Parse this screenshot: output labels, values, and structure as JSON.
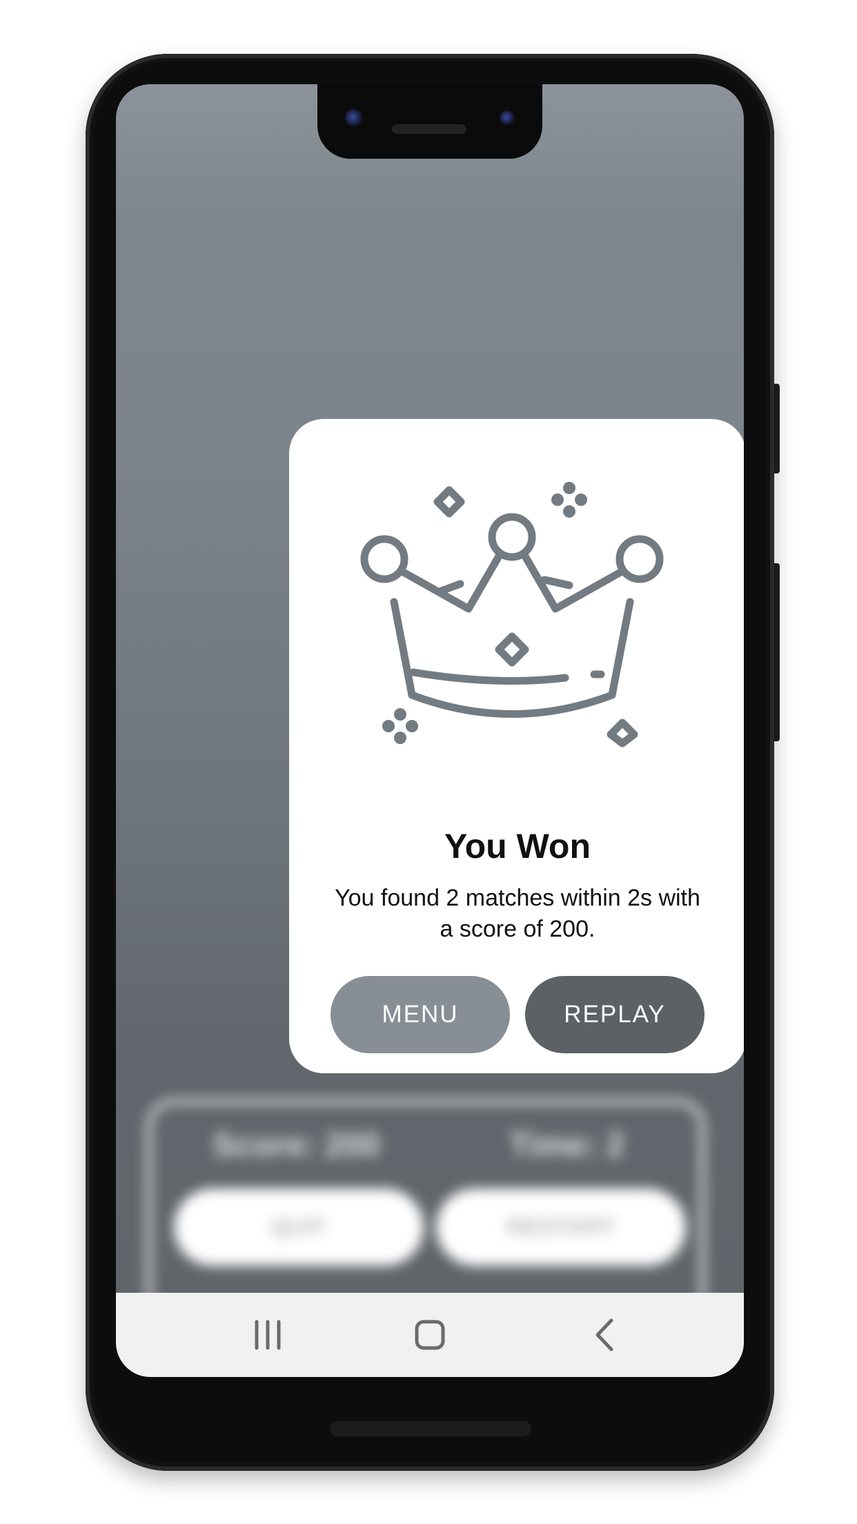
{
  "dialog": {
    "title": "You Won",
    "message": "You found 2 matches within 2s with a score of 200.",
    "menu_label": "MENU",
    "replay_label": "REPLAY",
    "icon": "crown-icon"
  },
  "background_game": {
    "score_label": "Score: 200",
    "time_label": "Time: 2",
    "quit_label": "QUIT",
    "restart_label": "RESTART"
  },
  "navigation": {
    "recents_icon": "recents-icon",
    "home_icon": "home-icon",
    "back_icon": "back-icon"
  },
  "colors": {
    "menu_button": "#878e95",
    "replay_button": "#5c6165",
    "crown_stroke": "#737b82",
    "card_red": "#d91d1d"
  }
}
